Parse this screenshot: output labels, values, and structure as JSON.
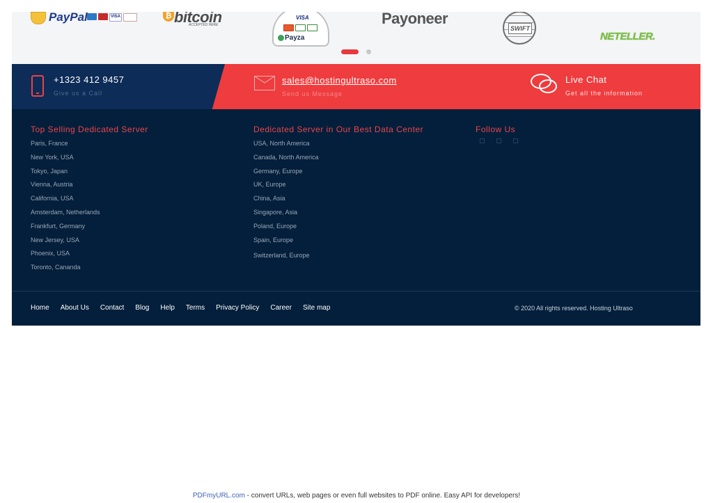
{
  "payments": {
    "paypal": "PayPal",
    "visa_card": "VISA",
    "bitcoin": "bitcoin",
    "bitcoin_symbol": "₿",
    "bitcoin_sub": "ACCEPTED HERE",
    "payza_visa": "VISA",
    "payza": "Payza",
    "payoneer": "Payoneer",
    "swift": "SWIFT",
    "neteller": "NETELLER."
  },
  "contact": {
    "phone": "+1323 412 9457",
    "phone_sub": "Give us a Call",
    "email": "sales@hostingultraso.com",
    "email_sub": "Send us Message",
    "chat": "Live Chat",
    "chat_sub": "Get all the information"
  },
  "footer": {
    "col1_title": "Top Selling Dedicated Server",
    "col1": [
      "Paris, France",
      "New York, USA",
      "Tokyo, Japan",
      "Vienna, Austria",
      "California, USA",
      "Amsterdam, Netherlands",
      "Frankfurt, Germany",
      "New Jersey, USA",
      "Phoenix, USA",
      "Toronto, Cananda"
    ],
    "col2_title": "Dedicated Server in Our Best Data Center",
    "col2": [
      "USA, North America",
      "Canada, North America",
      "Germany, Europe",
      "UK, Europe",
      "China, Asia",
      "Singapore, Asia",
      "Poland, Europe",
      "Spain, Europe",
      "Switzerland, Europe"
    ],
    "follow_title": "Follow Us",
    "nav": [
      "Home",
      "About Us",
      "Contact",
      "Blog",
      "Help",
      "Terms",
      "Privacy Policy",
      "Career",
      "Site map"
    ],
    "copyright": "© 2020 All rights reserved. Hosting Ultraso"
  },
  "pdf": {
    "link": "PDFmyURL.com",
    "text": " - convert URLs, web pages or even full websites to PDF online. Easy API for developers!"
  },
  "colors": {
    "accent": "#ef3c3e",
    "navy": "#0d2c57",
    "footer_bg": "#041f3b"
  }
}
